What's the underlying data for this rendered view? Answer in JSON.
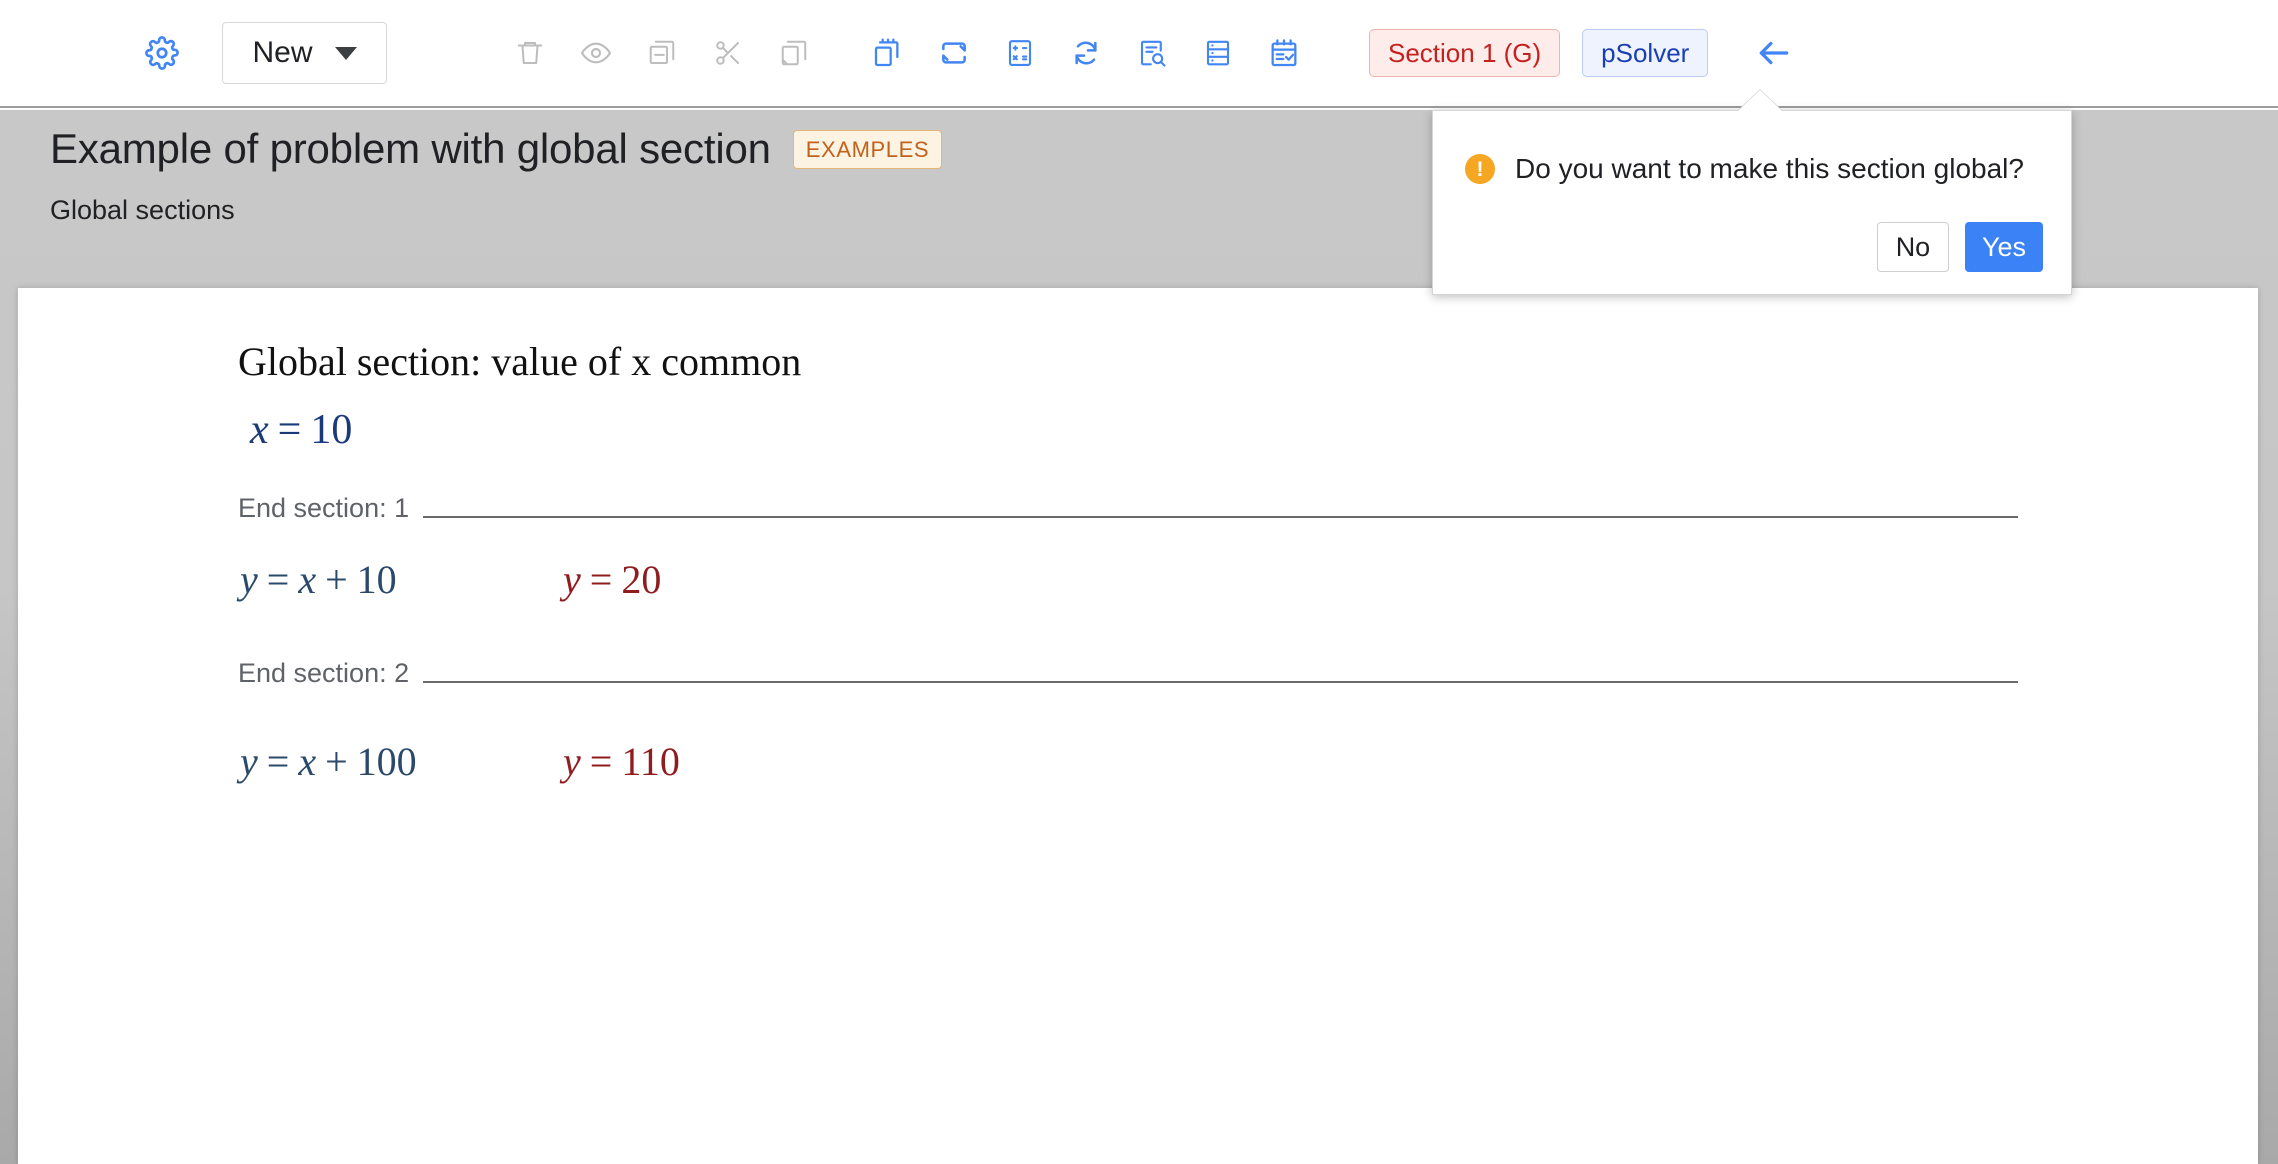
{
  "toolbar": {
    "gear_icon": "gear-icon",
    "new_button": {
      "label": "New",
      "chevron": "chevron-down-icon"
    },
    "gray_icons": [
      {
        "name": "trash-icon",
        "title": "Delete"
      },
      {
        "name": "eye-icon",
        "title": "Preview"
      },
      {
        "name": "copy-minus-icon",
        "title": "Remove copy"
      },
      {
        "name": "scissors-icon",
        "title": "Cut"
      },
      {
        "name": "copy-icon",
        "title": "Copy"
      }
    ],
    "blue_icons": [
      {
        "name": "paste-document-icon",
        "title": "Paste"
      },
      {
        "name": "loop-repeat-icon",
        "title": "Repeat"
      },
      {
        "name": "calculator-icon",
        "title": "Calculate"
      },
      {
        "name": "refresh-sync-icon",
        "title": "Refresh"
      },
      {
        "name": "document-search-icon",
        "title": "Find in document"
      },
      {
        "name": "list-table-icon",
        "title": "Table view"
      },
      {
        "name": "calendar-check-icon",
        "title": "Schedule"
      }
    ],
    "section_pill": "Section 1 (G)",
    "psolver_pill": "pSolver",
    "back_icon": "arrow-left-icon"
  },
  "header": {
    "title": "Example of problem with global section",
    "badge": "EXAMPLES",
    "subtitle": "Global sections"
  },
  "popup": {
    "icon": "warning-icon",
    "icon_glyph": "!",
    "message": "Do you want to make this section global?",
    "no_label": "No",
    "yes_label": "Yes"
  },
  "document": {
    "heading": "Global section: value of x common",
    "eq_global": {
      "lhs": "x",
      "eq": "=",
      "rhs": "10"
    },
    "end_section_1": "End section: 1",
    "eq_1_left": {
      "lhs": "y",
      "eq": "=",
      "t1": "x",
      "plus": "+",
      "t2": "10"
    },
    "eq_1_right": {
      "lhs": "y",
      "eq": "=",
      "rhs": "20"
    },
    "end_section_2": "End section: 2",
    "eq_2_left": {
      "lhs": "y",
      "eq": "=",
      "t1": "x",
      "plus": "+",
      "t2": "100"
    },
    "eq_2_right": {
      "lhs": "y",
      "eq": "=",
      "rhs": "110"
    }
  },
  "colors": {
    "accent_blue": "#3b82f6",
    "section_red": "#c5221f",
    "psolver_blue": "#1a3fb0",
    "badge_orange": "#c0621c",
    "warn_orange": "#f5a623",
    "math_blue": "#1a3a7a",
    "math_navy": "#2b4a6b",
    "math_red": "#8f1d20"
  }
}
